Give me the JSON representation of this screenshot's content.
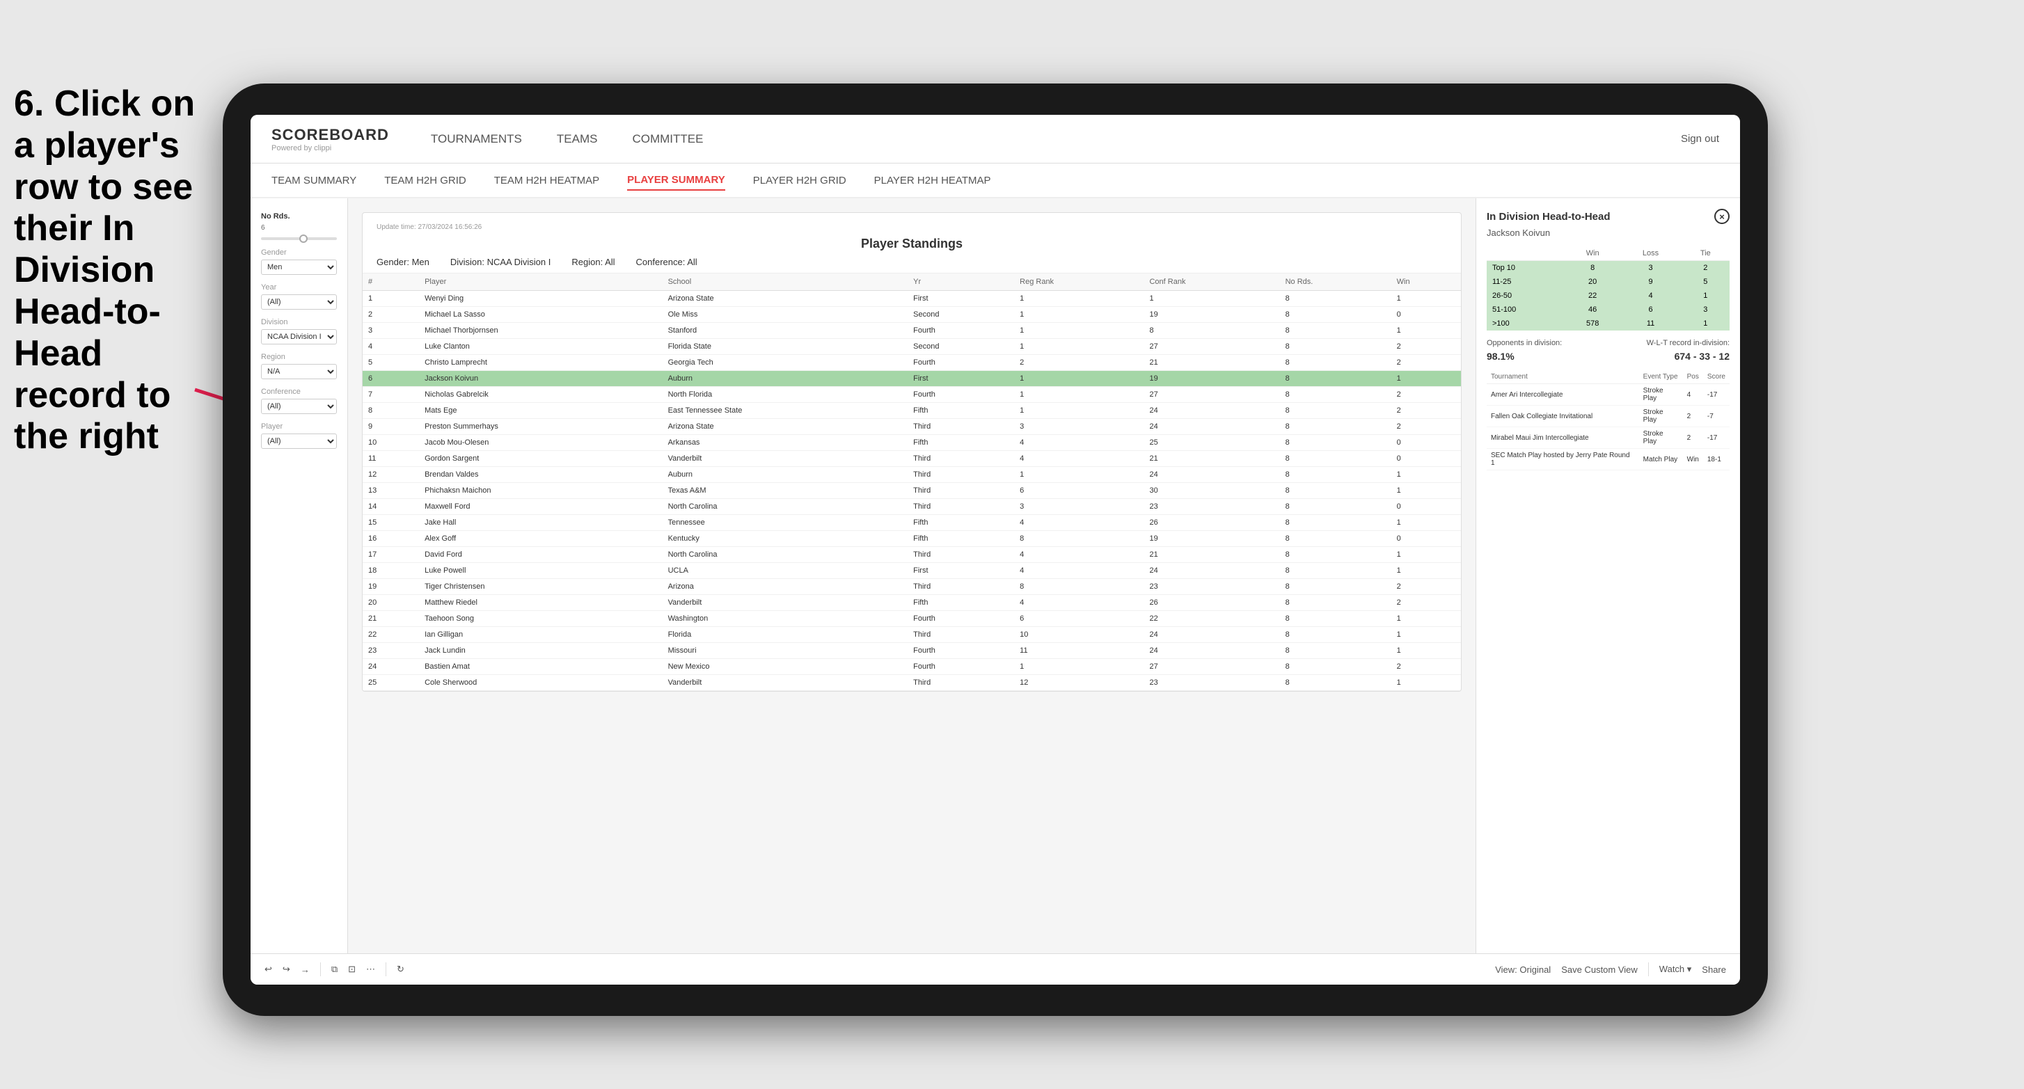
{
  "instruction": {
    "text": "6. Click on a player's row to see their In Division Head-to-Head record to the right"
  },
  "tablet": {
    "nav": {
      "logo": "SCOREBOARD",
      "logo_sub": "Powered by clippi",
      "links": [
        "TOURNAMENTS",
        "TEAMS",
        "COMMITTEE"
      ],
      "sign_out": "Sign out"
    },
    "sub_nav": {
      "links": [
        "TEAM SUMMARY",
        "TEAM H2H GRID",
        "TEAM H2H HEATMAP",
        "PLAYER SUMMARY",
        "PLAYER H2H GRID",
        "PLAYER H2H HEATMAP"
      ],
      "active": "PLAYER SUMMARY"
    },
    "filters": {
      "no_rds_label": "No Rds.",
      "gender_label": "Gender",
      "gender_value": "Men",
      "year_label": "Year",
      "year_value": "(All)",
      "division_label": "Division",
      "division_value": "NCAA Division I",
      "region_label": "Region",
      "region_value": "N/A",
      "conference_label": "Conference",
      "conference_value": "(All)",
      "player_label": "Player",
      "player_value": "(All)"
    },
    "standings": {
      "title": "Player Standings",
      "update_time": "Update time: 27/03/2024 16:56:26",
      "gender": "Gender: Men",
      "division": "Division: NCAA Division I",
      "region": "Region: All",
      "conference": "Conference: All",
      "columns": [
        "#",
        "Player",
        "School",
        "Yr",
        "Reg Rank",
        "Conf Rank",
        "No Rds.",
        "Win"
      ],
      "rows": [
        {
          "num": 1,
          "player": "Wenyi Ding",
          "school": "Arizona State",
          "yr": "First",
          "reg": 1,
          "conf": 1,
          "rds": 8,
          "win": 1
        },
        {
          "num": 2,
          "player": "Michael La Sasso",
          "school": "Ole Miss",
          "yr": "Second",
          "reg": 1,
          "conf": 19,
          "rds": 8,
          "win": 0
        },
        {
          "num": 3,
          "player": "Michael Thorbjornsen",
          "school": "Stanford",
          "yr": "Fourth",
          "reg": 1,
          "conf": 8,
          "rds": 8,
          "win": 1
        },
        {
          "num": 4,
          "player": "Luke Clanton",
          "school": "Florida State",
          "yr": "Second",
          "reg": 1,
          "conf": 27,
          "rds": 8,
          "win": 2
        },
        {
          "num": 5,
          "player": "Christo Lamprecht",
          "school": "Georgia Tech",
          "yr": "Fourth",
          "reg": 2,
          "conf": 21,
          "rds": 8,
          "win": 2
        },
        {
          "num": 6,
          "player": "Jackson Koivun",
          "school": "Auburn",
          "yr": "First",
          "reg": 1,
          "conf": 19,
          "rds": 8,
          "win": 1,
          "selected": true
        },
        {
          "num": 7,
          "player": "Nicholas Gabrelcik",
          "school": "North Florida",
          "yr": "Fourth",
          "reg": 1,
          "conf": 27,
          "rds": 8,
          "win": 2
        },
        {
          "num": 8,
          "player": "Mats Ege",
          "school": "East Tennessee State",
          "yr": "Fifth",
          "reg": 1,
          "conf": 24,
          "rds": 8,
          "win": 2
        },
        {
          "num": 9,
          "player": "Preston Summerhays",
          "school": "Arizona State",
          "yr": "Third",
          "reg": 3,
          "conf": 24,
          "rds": 8,
          "win": 2
        },
        {
          "num": 10,
          "player": "Jacob Mou-Olesen",
          "school": "Arkansas",
          "yr": "Fifth",
          "reg": 4,
          "conf": 25,
          "rds": 8,
          "win": 0
        },
        {
          "num": 11,
          "player": "Gordon Sargent",
          "school": "Vanderbilt",
          "yr": "Third",
          "reg": 4,
          "conf": 21,
          "rds": 8,
          "win": 0
        },
        {
          "num": 12,
          "player": "Brendan Valdes",
          "school": "Auburn",
          "yr": "Third",
          "reg": 1,
          "conf": 24,
          "rds": 8,
          "win": 1
        },
        {
          "num": 13,
          "player": "Phichaksn Maichon",
          "school": "Texas A&M",
          "yr": "Third",
          "reg": 6,
          "conf": 30,
          "rds": 8,
          "win": 1
        },
        {
          "num": 14,
          "player": "Maxwell Ford",
          "school": "North Carolina",
          "yr": "Third",
          "reg": 3,
          "conf": 23,
          "rds": 8,
          "win": 0
        },
        {
          "num": 15,
          "player": "Jake Hall",
          "school": "Tennessee",
          "yr": "Fifth",
          "reg": 4,
          "conf": 26,
          "rds": 8,
          "win": 1
        },
        {
          "num": 16,
          "player": "Alex Goff",
          "school": "Kentucky",
          "yr": "Fifth",
          "reg": 8,
          "conf": 19,
          "rds": 8,
          "win": 0
        },
        {
          "num": 17,
          "player": "David Ford",
          "school": "North Carolina",
          "yr": "Third",
          "reg": 4,
          "conf": 21,
          "rds": 8,
          "win": 1
        },
        {
          "num": 18,
          "player": "Luke Powell",
          "school": "UCLA",
          "yr": "First",
          "reg": 4,
          "conf": 24,
          "rds": 8,
          "win": 1
        },
        {
          "num": 19,
          "player": "Tiger Christensen",
          "school": "Arizona",
          "yr": "Third",
          "reg": 8,
          "conf": 23,
          "rds": 8,
          "win": 2
        },
        {
          "num": 20,
          "player": "Matthew Riedel",
          "school": "Vanderbilt",
          "yr": "Fifth",
          "reg": 4,
          "conf": 26,
          "rds": 8,
          "win": 2
        },
        {
          "num": 21,
          "player": "Taehoon Song",
          "school": "Washington",
          "yr": "Fourth",
          "reg": 6,
          "conf": 22,
          "rds": 8,
          "win": 1
        },
        {
          "num": 22,
          "player": "Ian Gilligan",
          "school": "Florida",
          "yr": "Third",
          "reg": 10,
          "conf": 24,
          "rds": 8,
          "win": 1
        },
        {
          "num": 23,
          "player": "Jack Lundin",
          "school": "Missouri",
          "yr": "Fourth",
          "reg": 11,
          "conf": 24,
          "rds": 8,
          "win": 1
        },
        {
          "num": 24,
          "player": "Bastien Amat",
          "school": "New Mexico",
          "yr": "Fourth",
          "reg": 1,
          "conf": 27,
          "rds": 8,
          "win": 2
        },
        {
          "num": 25,
          "player": "Cole Sherwood",
          "school": "Vanderbilt",
          "yr": "Third",
          "reg": 12,
          "conf": 23,
          "rds": 8,
          "win": 1
        }
      ]
    },
    "h2h": {
      "title": "In Division Head-to-Head",
      "player_name": "Jackson Koivun",
      "close_btn": "×",
      "columns": [
        "",
        "Win",
        "Loss",
        "Tie"
      ],
      "rows": [
        {
          "range": "Top 10",
          "win": 8,
          "loss": 3,
          "tie": 2,
          "highlight": true
        },
        {
          "range": "11-25",
          "win": 20,
          "loss": 9,
          "tie": 5,
          "highlight": true
        },
        {
          "range": "26-50",
          "win": 22,
          "loss": 4,
          "tie": 1,
          "highlight": true
        },
        {
          "range": "51-100",
          "win": 46,
          "loss": 6,
          "tie": 3,
          "highlight": true
        },
        {
          "range": ">100",
          "win": 578,
          "loss": 11,
          "tie": 1,
          "highlight": true
        }
      ],
      "opponents_label": "Opponents in division:",
      "wlt_label": "W-L-T record in-division:",
      "opponents_pct": "98.1%",
      "record": "674 - 33 - 12",
      "tournament_columns": [
        "Tournament",
        "Event Type",
        "Pos",
        "Score"
      ],
      "tournaments": [
        {
          "name": "Amer Ari Intercollegiate",
          "type": "Stroke Play",
          "pos": 4,
          "score": "-17"
        },
        {
          "name": "Fallen Oak Collegiate Invitational",
          "type": "Stroke Play",
          "pos": 2,
          "score": "-7"
        },
        {
          "name": "Mirabel Maui Jim Intercollegiate",
          "type": "Stroke Play",
          "pos": 2,
          "score": "-17"
        },
        {
          "name": "SEC Match Play hosted by Jerry Pate Round 1",
          "type": "Match Play",
          "pos": "Win",
          "score": "18-1"
        }
      ]
    },
    "toolbar": {
      "undo": "↩",
      "redo": "↪",
      "forward": "→",
      "copy": "⧉",
      "paste": "⊡",
      "more": "⋯",
      "refresh": "↻",
      "view_original": "View: Original",
      "save_custom": "Save Custom View",
      "watch": "Watch ▾",
      "share": "Share"
    }
  }
}
